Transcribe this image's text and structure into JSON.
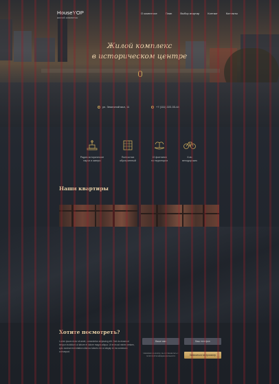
{
  "header": {
    "logo": "HouseYOP",
    "logo_sub": "жилой комплекс",
    "menu": [
      "О комплексе",
      "План",
      "Выбор квартир",
      "Контакт",
      "Контакты"
    ]
  },
  "hero": {
    "title_line1": "Жилой комплекс",
    "title_line2": "в историческом центре"
  },
  "contacts": {
    "address": "ул. Земляной вал, 11",
    "phone": "+7 (111) 222-33-44"
  },
  "features": [
    {
      "icon": "monument-icon",
      "label1": "Рядом исторические",
      "label2": "парки и скверы"
    },
    {
      "icon": "building-icon",
      "label1": "Полностью",
      "label2": "обустроенный"
    },
    {
      "icon": "fountain-icon",
      "label1": "10 фонтанов",
      "label2": "на территории"
    },
    {
      "icon": "bicycle-icon",
      "label1": "6 км",
      "label2": "велодорожек"
    }
  ],
  "apartments": {
    "title": "Наши квартиры"
  },
  "cta": {
    "title": "Хотите посмотреть?",
    "text": "Lorem ipsum dolor sit amet, consectetur adipiscing elit. Sed do eiusmod tempor incididunt ut labore et dolore magna aliqua. Ut enim ad minim veniam, quis nostrud exercitation ullamco laboris nisi ut aliquip ex ea commodo consequat.",
    "name_placeholder": "Ваше имя",
    "phone_placeholder": "Ваш телефон",
    "policy": "Нажимая на кнопку, вы соглашаетесь с политикой конфиденциальности",
    "submit_label": "Записаться на просмотр"
  },
  "colors": {
    "accent": "#c9a75a",
    "title_gold": "#e7cfa5",
    "background": "#1e2328"
  }
}
